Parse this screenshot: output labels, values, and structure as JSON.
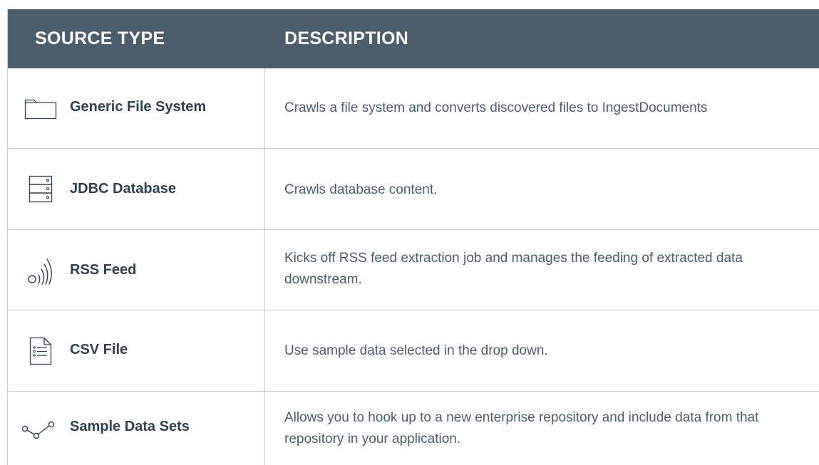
{
  "header": {
    "source_type": "SOURCE TYPE",
    "description": "DESCRIPTION"
  },
  "rows": [
    {
      "icon": "folder-icon",
      "label": "Generic File System",
      "description": "Crawls a file system and converts discovered files to IngestDocuments"
    },
    {
      "icon": "database-server-icon",
      "label": "JDBC Database",
      "description": "Crawls database content."
    },
    {
      "icon": "rss-feed-icon",
      "label": "RSS Feed",
      "description": "Kicks off RSS feed extraction job and manages the feeding of extracted data downstream."
    },
    {
      "icon": "document-file-icon",
      "label": "CSV File",
      "description": "Use sample data selected in the drop down."
    },
    {
      "icon": "connected-nodes-icon",
      "label": "Sample Data Sets",
      "description": "Allows you to hook up to a new enterprise repository and include data from that repository in your application."
    }
  ],
  "colors": {
    "header_bg": "#4b5e6d",
    "header_text": "#ffffff",
    "label_text": "#2f4150",
    "description_text": "#4d5d6b",
    "icon_stroke": "#2f4150",
    "border": "#c8cdd2"
  }
}
